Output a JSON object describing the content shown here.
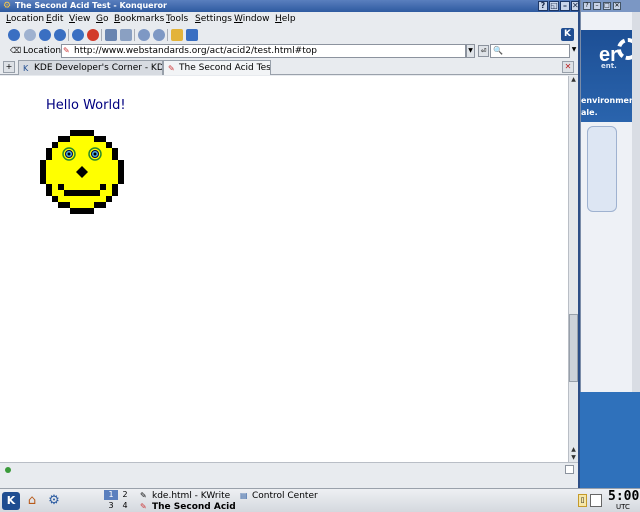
{
  "window": {
    "title": "The Second Acid Test - Konqueror",
    "buttons": [
      "?",
      "◱",
      "–",
      "□",
      "✕"
    ]
  },
  "menubar": {
    "items": [
      {
        "label": "Location",
        "accel": "L"
      },
      {
        "label": "Edit",
        "accel": "E"
      },
      {
        "label": "View",
        "accel": "V"
      },
      {
        "label": "Go",
        "accel": "G"
      },
      {
        "label": "Bookmarks",
        "accel": "B"
      },
      {
        "label": "Tools",
        "accel": "T"
      },
      {
        "label": "Settings",
        "accel": "S"
      },
      {
        "label": "Window",
        "accel": "W"
      },
      {
        "label": "Help",
        "accel": "H"
      }
    ]
  },
  "toolbar": {
    "icons": [
      "up-arrow-icon",
      "back-arrow-icon",
      "forward-arrow-icon",
      "home-icon",
      "reload-icon",
      "stop-icon",
      "print-icon",
      "print-preview-icon",
      "zoom-in-icon",
      "zoom-out-icon",
      "lock-icon",
      "download-icon"
    ],
    "corner_logo": "K"
  },
  "location": {
    "label": "Location:",
    "url": "http://www.webstandards.org/act/acid2/test.html#top"
  },
  "tabs": [
    {
      "title": "KDE Developer's Corner - KD...",
      "active": false
    },
    {
      "title": "The Second Acid Test",
      "active": true
    }
  ],
  "page": {
    "heading": "Hello World!"
  },
  "statusbar": {
    "text": ""
  },
  "taskbar": {
    "pager": [
      "1",
      "2",
      "3",
      "4"
    ],
    "tasks": [
      {
        "label": "kde.html - KWrite",
        "active": false
      },
      {
        "label": "Control Center",
        "active": false
      },
      {
        "label": "The Second Acid Te",
        "active": true
      }
    ],
    "clock": "5:00",
    "timezone": "UTC"
  },
  "background_window": {
    "banner_logo": "er",
    "banner_tag": "ent.",
    "banner_line1": "environment.",
    "banner_line2": "ale."
  },
  "colors": {
    "titlebar": "#2e5aa0",
    "heading": "#000080",
    "smiley_fill": "#ffff00",
    "smiley_outline": "#000000"
  }
}
